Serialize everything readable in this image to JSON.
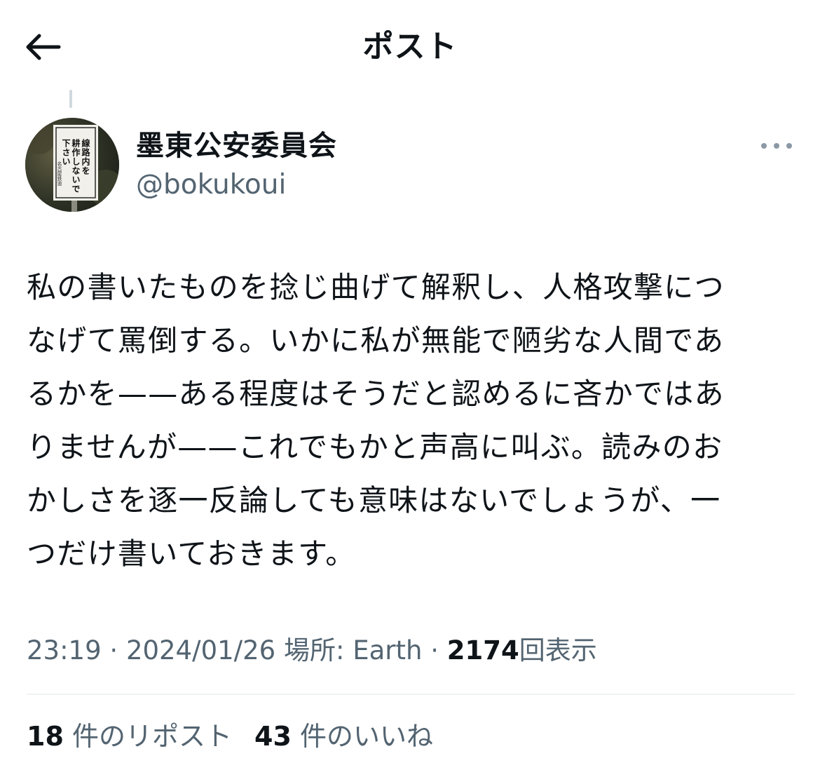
{
  "header": {
    "title": "ポスト",
    "back_icon": "arrow-left-icon"
  },
  "author": {
    "display_name": "墨東公安委員会",
    "handle": "@bokukoui",
    "avatar_sign_lines": [
      "線路内を",
      "耕作しないで",
      "下さい"
    ],
    "avatar_sign_footer": "名古屋鉄道",
    "more_icon": "more-options-icon"
  },
  "tweet": {
    "lines": [
      "私の書いたものを捻じ曲げて解釈し、人格攻撃につ",
      "なげて罵倒する。いかに私が無能で陋劣な人間であ",
      "るかを——ある程度はそうだと認めるに吝かではあ",
      "りませんが——これでもかと声高に叫ぶ。読みのお",
      "かしさを逐一反論しても意味はないでしょうが、一",
      "つだけ書いておきます。"
    ]
  },
  "meta": {
    "time": "23:19",
    "date": "2024/01/26",
    "location": "場所: Earth",
    "views_count": "2174",
    "views_label": "回表示",
    "separator": "·"
  },
  "stats": {
    "reposts_count": "18",
    "reposts_label": "件のリポスト",
    "likes_count": "43",
    "likes_label": "件のいいね"
  },
  "colors": {
    "text_primary": "#0f1419",
    "text_secondary": "#536471",
    "divider": "#eff3f4"
  }
}
